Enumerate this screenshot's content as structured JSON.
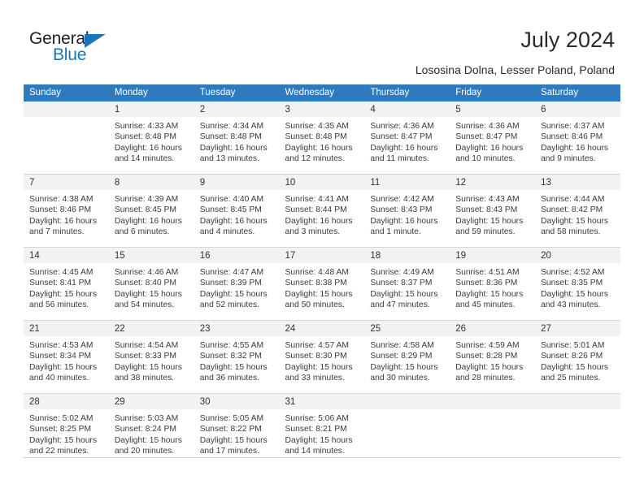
{
  "brand": {
    "name_part1": "General",
    "name_part2": "Blue",
    "accent_color": "#1b75bb"
  },
  "header": {
    "title": "July 2024",
    "subtitle": "Lososina Dolna, Lesser Poland, Poland",
    "header_bg_color": "#2f79bd",
    "daynum_bg_color": "#f2f2f2"
  },
  "weekdays": [
    "Sunday",
    "Monday",
    "Tuesday",
    "Wednesday",
    "Thursday",
    "Friday",
    "Saturday"
  ],
  "weeks": [
    [
      {
        "day": "",
        "lines": []
      },
      {
        "day": "1",
        "lines": [
          "Sunrise: 4:33 AM",
          "Sunset: 8:48 PM",
          "Daylight: 16 hours",
          "and 14 minutes."
        ]
      },
      {
        "day": "2",
        "lines": [
          "Sunrise: 4:34 AM",
          "Sunset: 8:48 PM",
          "Daylight: 16 hours",
          "and 13 minutes."
        ]
      },
      {
        "day": "3",
        "lines": [
          "Sunrise: 4:35 AM",
          "Sunset: 8:48 PM",
          "Daylight: 16 hours",
          "and 12 minutes."
        ]
      },
      {
        "day": "4",
        "lines": [
          "Sunrise: 4:36 AM",
          "Sunset: 8:47 PM",
          "Daylight: 16 hours",
          "and 11 minutes."
        ]
      },
      {
        "day": "5",
        "lines": [
          "Sunrise: 4:36 AM",
          "Sunset: 8:47 PM",
          "Daylight: 16 hours",
          "and 10 minutes."
        ]
      },
      {
        "day": "6",
        "lines": [
          "Sunrise: 4:37 AM",
          "Sunset: 8:46 PM",
          "Daylight: 16 hours",
          "and 9 minutes."
        ]
      }
    ],
    [
      {
        "day": "7",
        "lines": [
          "Sunrise: 4:38 AM",
          "Sunset: 8:46 PM",
          "Daylight: 16 hours",
          "and 7 minutes."
        ]
      },
      {
        "day": "8",
        "lines": [
          "Sunrise: 4:39 AM",
          "Sunset: 8:45 PM",
          "Daylight: 16 hours",
          "and 6 minutes."
        ]
      },
      {
        "day": "9",
        "lines": [
          "Sunrise: 4:40 AM",
          "Sunset: 8:45 PM",
          "Daylight: 16 hours",
          "and 4 minutes."
        ]
      },
      {
        "day": "10",
        "lines": [
          "Sunrise: 4:41 AM",
          "Sunset: 8:44 PM",
          "Daylight: 16 hours",
          "and 3 minutes."
        ]
      },
      {
        "day": "11",
        "lines": [
          "Sunrise: 4:42 AM",
          "Sunset: 8:43 PM",
          "Daylight: 16 hours",
          "and 1 minute."
        ]
      },
      {
        "day": "12",
        "lines": [
          "Sunrise: 4:43 AM",
          "Sunset: 8:43 PM",
          "Daylight: 15 hours",
          "and 59 minutes."
        ]
      },
      {
        "day": "13",
        "lines": [
          "Sunrise: 4:44 AM",
          "Sunset: 8:42 PM",
          "Daylight: 15 hours",
          "and 58 minutes."
        ]
      }
    ],
    [
      {
        "day": "14",
        "lines": [
          "Sunrise: 4:45 AM",
          "Sunset: 8:41 PM",
          "Daylight: 15 hours",
          "and 56 minutes."
        ]
      },
      {
        "day": "15",
        "lines": [
          "Sunrise: 4:46 AM",
          "Sunset: 8:40 PM",
          "Daylight: 15 hours",
          "and 54 minutes."
        ]
      },
      {
        "day": "16",
        "lines": [
          "Sunrise: 4:47 AM",
          "Sunset: 8:39 PM",
          "Daylight: 15 hours",
          "and 52 minutes."
        ]
      },
      {
        "day": "17",
        "lines": [
          "Sunrise: 4:48 AM",
          "Sunset: 8:38 PM",
          "Daylight: 15 hours",
          "and 50 minutes."
        ]
      },
      {
        "day": "18",
        "lines": [
          "Sunrise: 4:49 AM",
          "Sunset: 8:37 PM",
          "Daylight: 15 hours",
          "and 47 minutes."
        ]
      },
      {
        "day": "19",
        "lines": [
          "Sunrise: 4:51 AM",
          "Sunset: 8:36 PM",
          "Daylight: 15 hours",
          "and 45 minutes."
        ]
      },
      {
        "day": "20",
        "lines": [
          "Sunrise: 4:52 AM",
          "Sunset: 8:35 PM",
          "Daylight: 15 hours",
          "and 43 minutes."
        ]
      }
    ],
    [
      {
        "day": "21",
        "lines": [
          "Sunrise: 4:53 AM",
          "Sunset: 8:34 PM",
          "Daylight: 15 hours",
          "and 40 minutes."
        ]
      },
      {
        "day": "22",
        "lines": [
          "Sunrise: 4:54 AM",
          "Sunset: 8:33 PM",
          "Daylight: 15 hours",
          "and 38 minutes."
        ]
      },
      {
        "day": "23",
        "lines": [
          "Sunrise: 4:55 AM",
          "Sunset: 8:32 PM",
          "Daylight: 15 hours",
          "and 36 minutes."
        ]
      },
      {
        "day": "24",
        "lines": [
          "Sunrise: 4:57 AM",
          "Sunset: 8:30 PM",
          "Daylight: 15 hours",
          "and 33 minutes."
        ]
      },
      {
        "day": "25",
        "lines": [
          "Sunrise: 4:58 AM",
          "Sunset: 8:29 PM",
          "Daylight: 15 hours",
          "and 30 minutes."
        ]
      },
      {
        "day": "26",
        "lines": [
          "Sunrise: 4:59 AM",
          "Sunset: 8:28 PM",
          "Daylight: 15 hours",
          "and 28 minutes."
        ]
      },
      {
        "day": "27",
        "lines": [
          "Sunrise: 5:01 AM",
          "Sunset: 8:26 PM",
          "Daylight: 15 hours",
          "and 25 minutes."
        ]
      }
    ],
    [
      {
        "day": "28",
        "lines": [
          "Sunrise: 5:02 AM",
          "Sunset: 8:25 PM",
          "Daylight: 15 hours",
          "and 22 minutes."
        ]
      },
      {
        "day": "29",
        "lines": [
          "Sunrise: 5:03 AM",
          "Sunset: 8:24 PM",
          "Daylight: 15 hours",
          "and 20 minutes."
        ]
      },
      {
        "day": "30",
        "lines": [
          "Sunrise: 5:05 AM",
          "Sunset: 8:22 PM",
          "Daylight: 15 hours",
          "and 17 minutes."
        ]
      },
      {
        "day": "31",
        "lines": [
          "Sunrise: 5:06 AM",
          "Sunset: 8:21 PM",
          "Daylight: 15 hours",
          "and 14 minutes."
        ]
      },
      {
        "day": "",
        "lines": []
      },
      {
        "day": "",
        "lines": []
      },
      {
        "day": "",
        "lines": []
      }
    ]
  ]
}
